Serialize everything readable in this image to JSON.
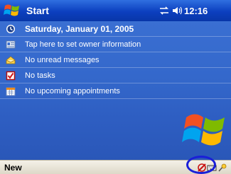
{
  "titlebar": {
    "title": "Start",
    "time": "12:16"
  },
  "today": {
    "date": "Saturday, January 01, 2005",
    "owner": "Tap here to set owner information",
    "messages": "No unread messages",
    "tasks": "No tasks",
    "appointments": "No upcoming appointments"
  },
  "menubar": {
    "new_label": "New"
  },
  "colors": {
    "title_bg": "#0c3fbf",
    "today_bg": "#3468cb",
    "menubar_bg": "#e8e4d8",
    "highlight_ring": "#1a1fd8"
  }
}
